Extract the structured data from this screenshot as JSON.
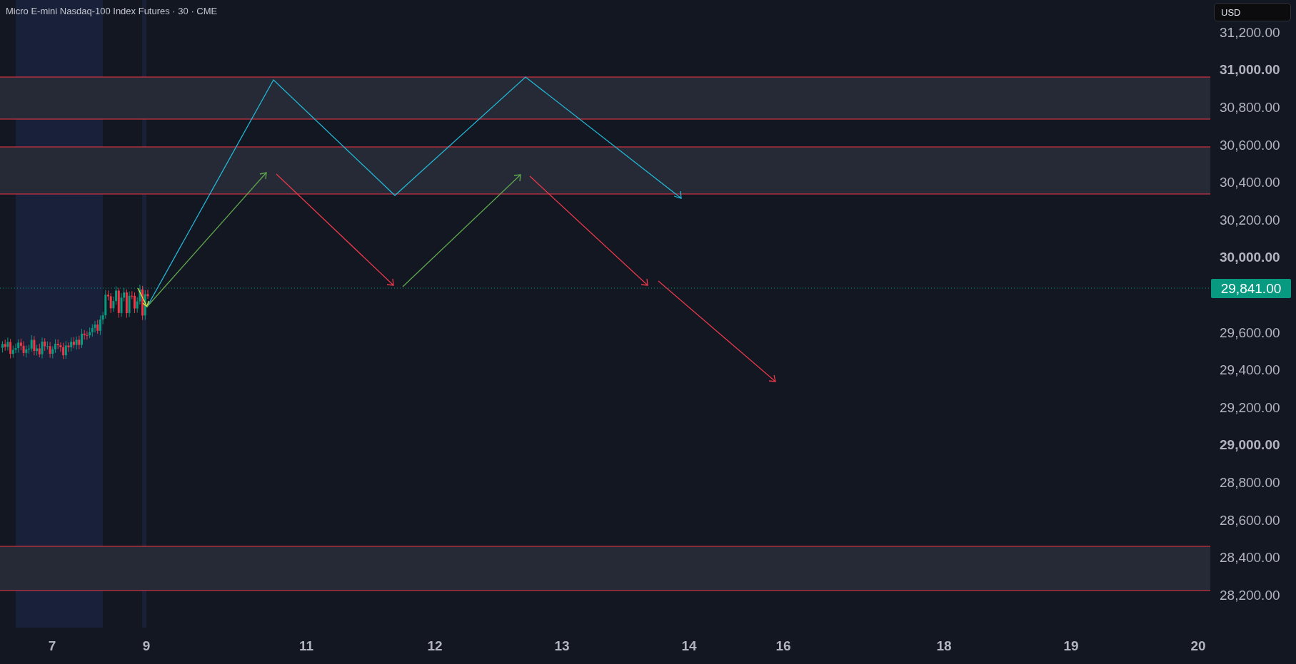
{
  "title": "Micro E-mini Nasdaq-100 Index Futures · 30 · CME",
  "currency": "USD",
  "price_axis": [
    {
      "label": "31,200.00",
      "major": false
    },
    {
      "label": "31,000.00",
      "major": true
    },
    {
      "label": "30,800.00",
      "major": false
    },
    {
      "label": "30,600.00",
      "major": false
    },
    {
      "label": "30,400.00",
      "major": false
    },
    {
      "label": "30,200.00",
      "major": false
    },
    {
      "label": "30,000.00",
      "major": true
    },
    {
      "label": "29,600.00",
      "major": false
    },
    {
      "label": "29,400.00",
      "major": false
    },
    {
      "label": "29,200.00",
      "major": false
    },
    {
      "label": "29,000.00",
      "major": true
    },
    {
      "label": "28,800.00",
      "major": false
    },
    {
      "label": "28,600.00",
      "major": false
    },
    {
      "label": "28,400.00",
      "major": false
    },
    {
      "label": "28,200.00",
      "major": false
    }
  ],
  "current_price": "29,841.00",
  "time_axis": [
    "7",
    "9",
    "11",
    "12",
    "13",
    "14",
    "16",
    "18",
    "19",
    "20"
  ]
}
